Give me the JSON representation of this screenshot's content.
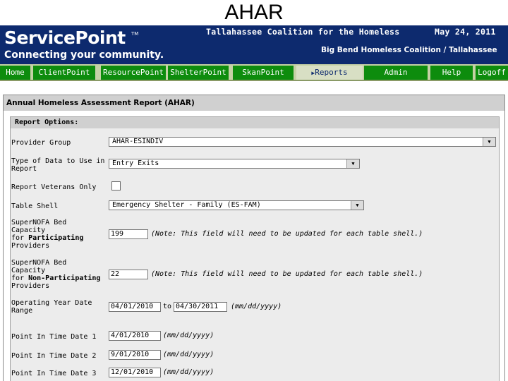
{
  "slide_title": "AHAR",
  "header": {
    "logo_text": "ServicePoint",
    "logo_tm": "TM",
    "tagline": "Connecting your community.",
    "organization": "Tallahassee Coalition for the Homeless",
    "date": "May 24, 2011",
    "coalition": "Big Bend Homeless Coalition / Tallahassee"
  },
  "nav": {
    "tabs": [
      {
        "label": "Home"
      },
      {
        "label": "ClientPoint"
      },
      {
        "label": "ResourcePoint"
      },
      {
        "label": "ShelterPoint"
      },
      {
        "label": "SkanPoint"
      },
      {
        "label": "Reports",
        "active": true
      },
      {
        "label": "Admin"
      },
      {
        "label": "Help"
      },
      {
        "label": "Logoff"
      }
    ],
    "active_icon": "play-triangle-icon"
  },
  "panel": {
    "title": "Annual Homeless Assessment Report (AHAR)",
    "options_header": "Report Options:"
  },
  "form": {
    "provider_group": {
      "label": "Provider Group",
      "value": "AHAR-ESINDIV"
    },
    "data_type": {
      "label_line1": "Type of Data to Use in",
      "label_line2": "Report",
      "value": "Entry Exits"
    },
    "veterans_only": {
      "label": "Report Veterans Only",
      "checked": false
    },
    "table_shell": {
      "label": "Table Shell",
      "value": "Emergency Shelter - Family (ES-FAM)"
    },
    "participating": {
      "label_line1": "SuperNOFA Bed",
      "label_line2": "Capacity",
      "label_prefix": "for ",
      "label_bold": "Participating",
      "label_line4": "Providers",
      "value": "199",
      "note": "(Note: This field will need to be updated for each table shell.)"
    },
    "non_participating": {
      "label_line1": "SuperNOFA Bed",
      "label_line2": "Capacity",
      "label_prefix": "for ",
      "label_bold": "Non-Participating",
      "label_line4": "Providers",
      "value": "22",
      "note": "(Note: This field will need to be updated for each table shell.)"
    },
    "operating_year": {
      "label_line1": "Operating Year Date",
      "label_line2": "Range",
      "start": "04/01/2010",
      "to": "to",
      "end": "04/30/2011",
      "format": "(mm/dd/yyyy)"
    },
    "pit1": {
      "label": "Point In Time Date 1",
      "value": "4/01/2010",
      "format": "(mm/dd/yyyy)"
    },
    "pit2": {
      "label": "Point In Time Date 2",
      "value": "9/01/2010",
      "format": "(mm/dd/yyyy)"
    },
    "pit3": {
      "label": "Point In Time Date 3",
      "value": "12/01/2010",
      "format": "(mm/dd/yyyy)"
    }
  },
  "colors": {
    "header_bg": "#0d2a6e",
    "tab_bg": "#0d8c0d",
    "tab_active_bg": "#d8dfc4"
  }
}
